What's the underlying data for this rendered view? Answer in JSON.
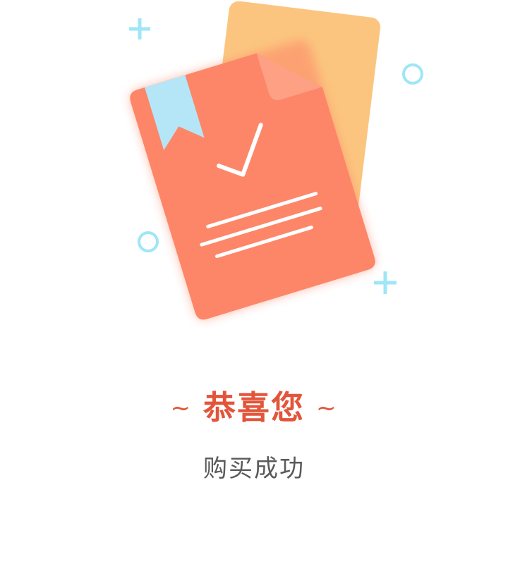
{
  "illustration": {
    "icon": "purchase-success-document-icon",
    "colors": {
      "back_card": "#fbc57f",
      "front_card": "#fd8668",
      "folded_corner": "#fda083",
      "bookmark": "#b4e6f7",
      "decoration": "#9fe6f7",
      "check": "#ffffff"
    }
  },
  "message": {
    "tilde_left": "~",
    "title": "恭喜您",
    "tilde_right": "~",
    "subtitle": "购买成功"
  },
  "colors": {
    "title": "#e2553a",
    "subtitle": "#5a5a5a"
  }
}
